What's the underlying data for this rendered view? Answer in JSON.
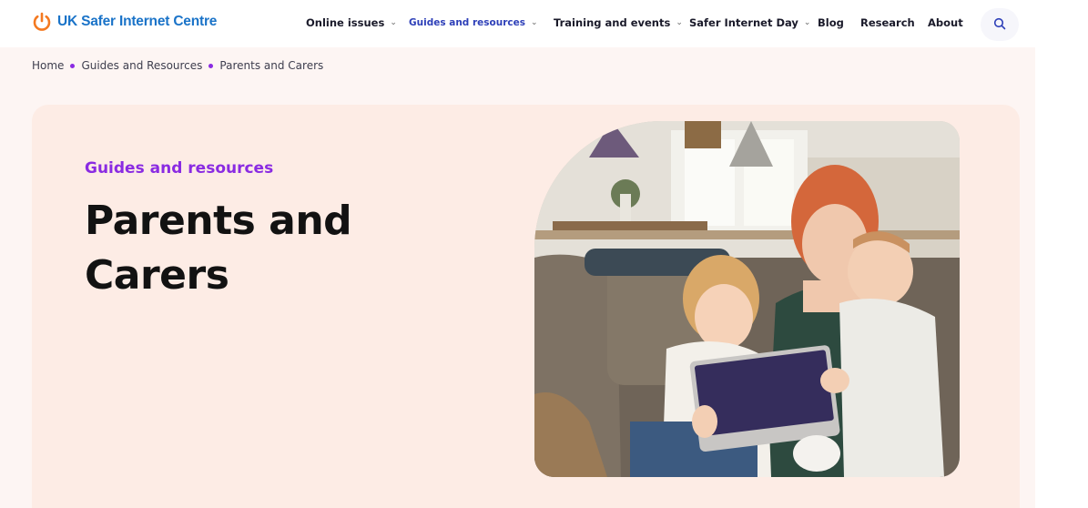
{
  "logo": {
    "text": "UK Safer Internet Centre",
    "icon": "power-icon",
    "color": "#1a73c8",
    "icon_color": "#f47920"
  },
  "nav": {
    "items": [
      {
        "label": "Online issues",
        "has_dropdown": true,
        "active": false
      },
      {
        "label": "Guides and resources",
        "has_dropdown": true,
        "active": true
      },
      {
        "label": "Training and events",
        "has_dropdown": true,
        "active": false
      },
      {
        "label": "Safer Internet Day",
        "has_dropdown": true,
        "active": false
      },
      {
        "label": "Blog",
        "has_dropdown": false,
        "active": false
      },
      {
        "label": "Research",
        "has_dropdown": false,
        "active": false
      },
      {
        "label": "About",
        "has_dropdown": false,
        "active": false
      }
    ],
    "search_icon": "search-icon"
  },
  "breadcrumb": {
    "items": [
      "Home",
      "Guides and Resources",
      "Parents and Carers"
    ],
    "separator_color": "#8a2be2"
  },
  "hero": {
    "eyebrow": "Guides and resources",
    "title": "Parents and Carers",
    "eyebrow_color": "#8a2be2",
    "background": "#fdece5"
  }
}
